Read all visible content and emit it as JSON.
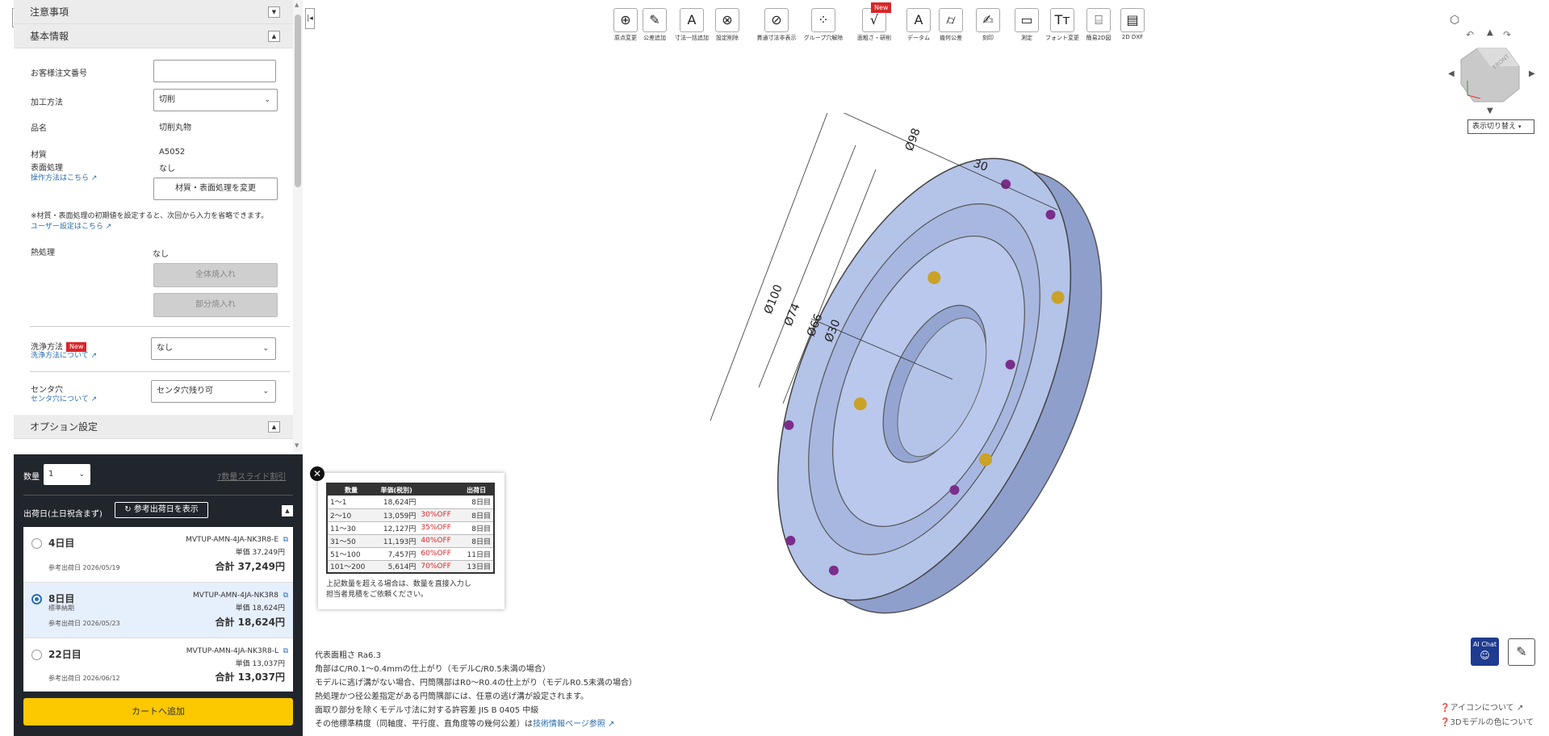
{
  "sections": {
    "notes_header": "注意事項",
    "basic_header": "基本情報",
    "option_header": "オプション設定"
  },
  "form": {
    "order_no_label": "お客様注文番号",
    "order_no_value": "",
    "process_label": "加工方法",
    "process_value": "切削",
    "item_label": "品名",
    "item_value": "切削丸物",
    "material_label": "材質",
    "material_value": "A5052",
    "surface_label": "表面処理",
    "surface_value": "なし",
    "howto_link": "操作方法はこちら",
    "change_button": "材質・表面処理を変更",
    "note_default": "※材質・表面処理の初期値を設定すると、次回から入力を省略できます。",
    "user_setting_link": "ユーザー設定はこちら",
    "heat_label": "熱処理",
    "heat_value": "なし",
    "heat_full_button": "全体焼入れ",
    "heat_partial_button": "部分焼入れ",
    "wash_label": "洗浄方法",
    "new_badge": "New",
    "wash_link": "洗浄方法について",
    "wash_value": "なし",
    "center_label": "センタ穴",
    "center_link": "センタ穴について",
    "center_value": "センタ穴残り可"
  },
  "order": {
    "qty_label": "数量",
    "qty_value": "1",
    "slide_discount": "数量スライド割引",
    "ship_label": "出荷日(土日祝含まず)",
    "ref_ship_button": "参考出荷日を表示",
    "options": [
      {
        "days": "4日目",
        "sub": "",
        "code": "MVTUP-AMN-4JA-NK3R8-E",
        "unit": "単価 37,249円",
        "ref": "参考出荷日 2026/05/19",
        "total": "合計 37,249円",
        "selected": false
      },
      {
        "days": "8日目",
        "sub": "標準納期",
        "code": "MVTUP-AMN-4JA-NK3R8",
        "unit": "単価 18,624円",
        "ref": "参考出荷日 2026/05/23",
        "total": "合計 18,624円",
        "selected": true
      },
      {
        "days": "22日目",
        "sub": "",
        "code": "MVTUP-AMN-4JA-NK3R8-L",
        "unit": "単価 13,037円",
        "ref": "参考出荷日 2026/06/12",
        "total": "合計 13,037円",
        "selected": false
      }
    ],
    "cart_button": "カートへ追加"
  },
  "toolbar": [
    {
      "label": "原点変更",
      "icon": "origin-icon",
      "glyph": "⊕"
    },
    {
      "label": "公差追加",
      "icon": "tolerance-add-icon",
      "glyph": "✎"
    },
    {
      "label": "寸法一括追加",
      "icon": "dimension-batch-icon",
      "glyph": "A"
    },
    {
      "label": "設定削除",
      "icon": "delete-setting-icon",
      "glyph": "⊗"
    },
    {
      "label": "貫通寸法非表示",
      "icon": "hide-through-icon",
      "glyph": "⊘"
    },
    {
      "label": "グループ穴解除",
      "icon": "group-hole-icon",
      "glyph": "⁘"
    },
    {
      "label": "面粗さ・研削",
      "icon": "roughness-icon",
      "glyph": "√"
    },
    {
      "label": "データム",
      "icon": "datum-icon",
      "glyph": "A"
    },
    {
      "label": "幾何公差",
      "icon": "geometric-tolerance-icon",
      "glyph": "⌭"
    },
    {
      "label": "刻印",
      "icon": "stamp-icon",
      "glyph": "✍"
    },
    {
      "label": "測定",
      "icon": "measure-icon",
      "glyph": "▭"
    },
    {
      "label": "フォント変更",
      "icon": "font-icon",
      "glyph": "Tт"
    },
    {
      "label": "簡易2D図",
      "icon": "simple-2d-icon",
      "glyph": "⌸"
    },
    {
      "label": "2D DXF",
      "icon": "dxf-icon",
      "glyph": "▤"
    }
  ],
  "toolbar_new_badge": "New",
  "view": {
    "switch_button": "表示切り替え"
  },
  "dims": {
    "d98": "Ø98",
    "d30a": "30",
    "d100": "Ø100",
    "d74": "Ø74",
    "d66": "Ø66",
    "d30": "Ø30"
  },
  "price_table": {
    "headers": [
      "数量",
      "単価(税別)",
      "",
      "出荷日"
    ],
    "rows": [
      [
        "1～1",
        "18,624円",
        "",
        "8日目"
      ],
      [
        "2～10",
        "13,059円",
        "30%OFF",
        "8日目"
      ],
      [
        "11～30",
        "12,127円",
        "35%OFF",
        "8日目"
      ],
      [
        "31～50",
        "11,193円",
        "40%OFF",
        "8日目"
      ],
      [
        "51～100",
        "7,457円",
        "60%OFF",
        "11日目"
      ],
      [
        "101～200",
        "5,614円",
        "70%OFF",
        "13日目"
      ]
    ],
    "note1": "上記数量を超える場合は、数量を直接入力し",
    "note2": "担当者見積をご依頼ください。"
  },
  "notes": {
    "l1": "代表面粗さ Ra6.3",
    "l2": "角部はC/R0.1～0.4mmの仕上がり（モデルC/R0.5未満の場合）",
    "l3": "モデルに逃げ溝がない場合、円筒隅部はR0～R0.4の仕上がり（モデルR0.5未満の場合）",
    "l4": "熱処理かつ径公差指定がある円筒隅部には、任意の逃げ溝が設定されます。",
    "l5": "面取り部分を除くモデル寸法に対する許容差 JIS B 0405 中級",
    "l6_prefix": "その他標準精度（同軸度、平行度、直角度等の幾何公差）は",
    "l6_link": "技術情報ページ参照"
  },
  "ai_chat": "AI Chat",
  "footer": {
    "icon_about": "アイコンについて",
    "model_color": "3Dモデルの色について"
  },
  "colors": {
    "model": "#b4c3e8",
    "cart": "#fcc800",
    "link": "#2a6db0",
    "off": "#d9262a",
    "dark_panel": "#21252c"
  }
}
